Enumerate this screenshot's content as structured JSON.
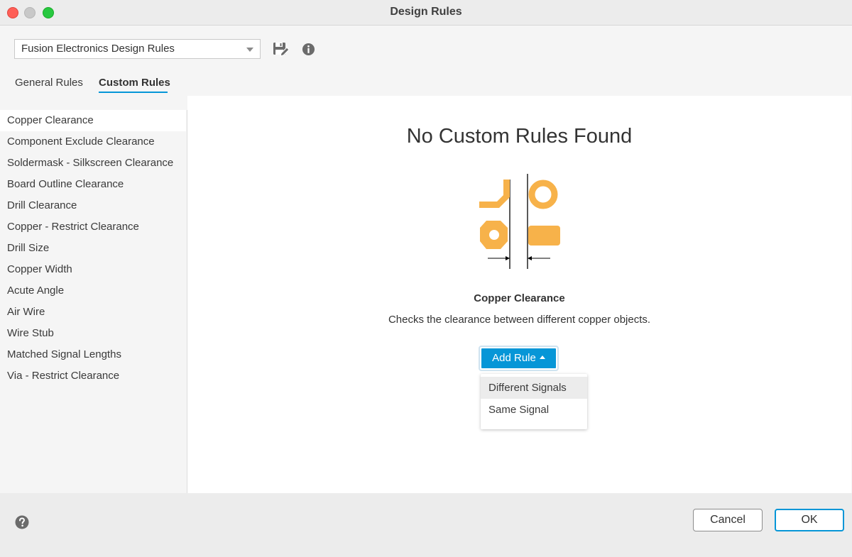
{
  "window": {
    "title": "Design Rules"
  },
  "toolbar": {
    "preset": {
      "value": "Fusion Electronics Design Rules"
    },
    "icons": {
      "save": "save-edit-icon",
      "info": "info-icon"
    }
  },
  "tabs": [
    {
      "label": "General Rules",
      "active": false
    },
    {
      "label": "Custom Rules",
      "active": true
    }
  ],
  "sidebar": {
    "items": [
      {
        "label": "Copper Clearance",
        "active": true
      },
      {
        "label": "Component Exclude Clearance"
      },
      {
        "label": "Soldermask - Silkscreen Clearance"
      },
      {
        "label": "Board Outline Clearance"
      },
      {
        "label": "Drill Clearance"
      },
      {
        "label": "Copper - Restrict Clearance"
      },
      {
        "label": "Drill Size"
      },
      {
        "label": "Copper Width"
      },
      {
        "label": "Acute Angle"
      },
      {
        "label": "Air Wire"
      },
      {
        "label": "Wire Stub"
      },
      {
        "label": "Matched Signal Lengths"
      },
      {
        "label": "Via - Restrict Clearance"
      }
    ]
  },
  "main": {
    "heading": "No Custom Rules Found",
    "rule_title": "Copper Clearance",
    "rule_description": "Checks the clearance between different copper objects.",
    "add_rule_label": "Add Rule",
    "dropdown": [
      {
        "label": "Different Signals",
        "highlighted": true
      },
      {
        "label": "Same Signal"
      }
    ],
    "illustration_color": "#f7b24a"
  },
  "footer": {
    "cancel_label": "Cancel",
    "ok_label": "OK",
    "accent": "#0696d7"
  }
}
